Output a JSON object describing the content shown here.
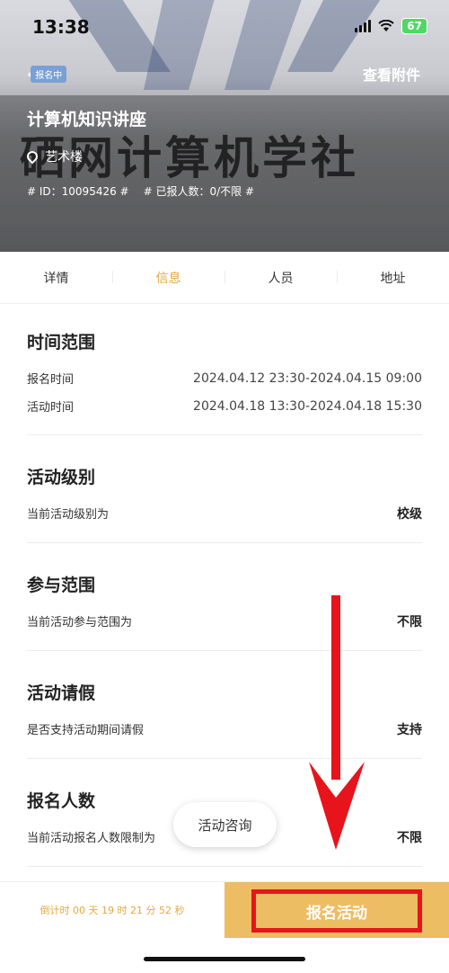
{
  "status_bar": {
    "time": "13:38",
    "battery": "67"
  },
  "header": {
    "badge": "报名中",
    "attachment_link": "查看附件",
    "title": "计算机知识讲座",
    "location": "艺术楼",
    "id_text": "# ID：10095426 #",
    "registered_text": "# 已报人数：0/不限 #",
    "watermark": "硒网计算机学社"
  },
  "tabs": [
    "详情",
    "信息",
    "人员",
    "地址"
  ],
  "active_tab": "信息",
  "sections": {
    "time": {
      "title": "时间范围",
      "rows": [
        {
          "label": "报名时间",
          "value": "2024.04.12 23:30-2024.04.15 09:00"
        },
        {
          "label": "活动时间",
          "value": "2024.04.18 13:30-2024.04.18 15:30"
        }
      ]
    },
    "level": {
      "title": "活动级别",
      "label": "当前活动级别为",
      "value": "校级"
    },
    "scope": {
      "title": "参与范围",
      "label": "当前活动参与范围为",
      "value": "不限"
    },
    "leave": {
      "title": "活动请假",
      "label": "是否支持活动期间请假",
      "value": "支持"
    },
    "quota": {
      "title": "报名人数",
      "label": "当前活动报名人数限制为",
      "value": "不限"
    }
  },
  "consult_button": "活动咨询",
  "bottom_bar": {
    "countdown": "倒计时 00 天 19 时 21 分 52 秒",
    "register_button": "报名活动"
  },
  "colors": {
    "accent": "#e4a93f",
    "button_bg": "#edbd64",
    "highlight": "#e8141b"
  }
}
